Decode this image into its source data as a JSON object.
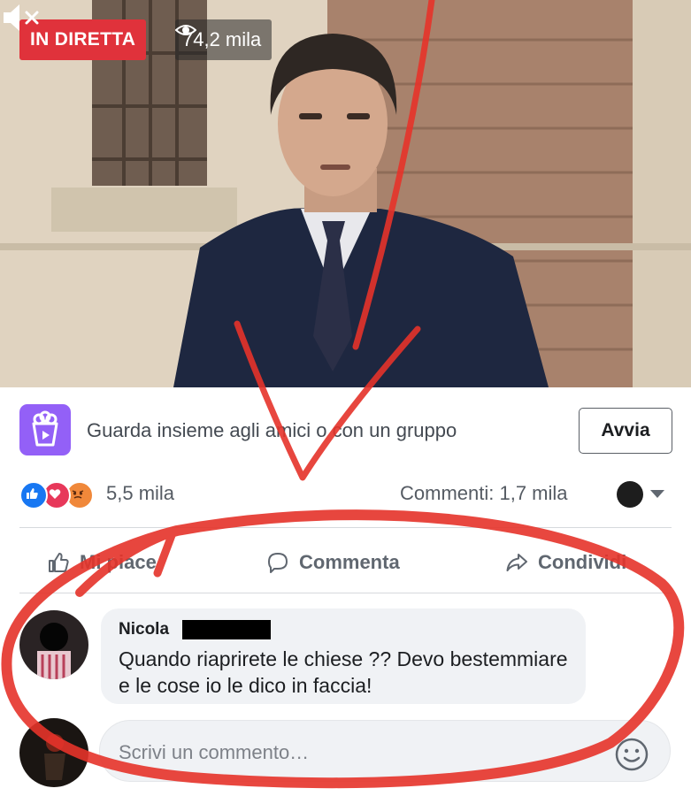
{
  "video": {
    "live_label": "IN DIRETTA",
    "viewer_count": "74,2 mila",
    "mute_icon": "speaker-muted-icon"
  },
  "watch_party": {
    "icon": "watch-party-icon",
    "text": "Guarda insieme agli amici o con un gruppo",
    "button_label": "Avvia"
  },
  "stats": {
    "reaction_icons": [
      "like-icon",
      "love-icon",
      "angry-icon"
    ],
    "reaction_count": "5,5 mila",
    "comments_count": "Commenti: 1,7 mila"
  },
  "actions": {
    "like_label": "Mi piace",
    "comment_label": "Commenta",
    "share_label": "Condividi"
  },
  "comment": {
    "author": "Nicola",
    "text": "Quando riaprirete le chiese ?? Devo bestemmiare e le cose io le dico in faccia!"
  },
  "composer": {
    "placeholder": "Scrivi un commento…",
    "emoji_icon": "smiley-icon"
  },
  "colors": {
    "live_red": "#e0323b",
    "brand_blue": "#1877f2",
    "watch_party_purple": "#9360f7",
    "marker_red": "#e5332a"
  }
}
